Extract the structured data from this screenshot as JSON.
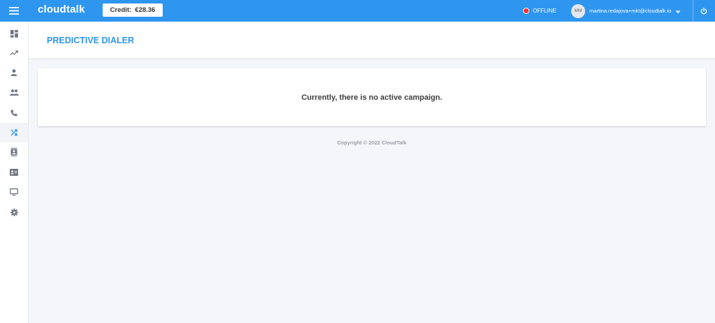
{
  "topbar": {
    "brand": "cloudtalk",
    "credit_label": "Credit:",
    "credit_value": "€28.36",
    "status_label": "OFFLINE",
    "avatar_initials": "MM",
    "user_email": "martina.redajova+mkt@cloudtalk.io"
  },
  "sidebar": {
    "items": [
      {
        "icon": "dashboard-icon"
      },
      {
        "icon": "analytics-trend-icon"
      },
      {
        "icon": "person-icon"
      },
      {
        "icon": "people-icon"
      },
      {
        "icon": "phone-icon"
      },
      {
        "icon": "shuffle-icon",
        "active": true
      },
      {
        "icon": "contacts-book-icon"
      },
      {
        "icon": "contact-card-icon"
      },
      {
        "icon": "monitor-icon"
      },
      {
        "icon": "settings-icon"
      }
    ]
  },
  "page": {
    "title": "PREDICTIVE DIALER",
    "empty_message": "Currently, there is no active campaign.",
    "copyright": "Copyright © 2022 CloudTalk"
  },
  "colors": {
    "brand_blue": "#2f96ef",
    "offline_red": "#ff3131",
    "background": "#f4f6fa"
  }
}
